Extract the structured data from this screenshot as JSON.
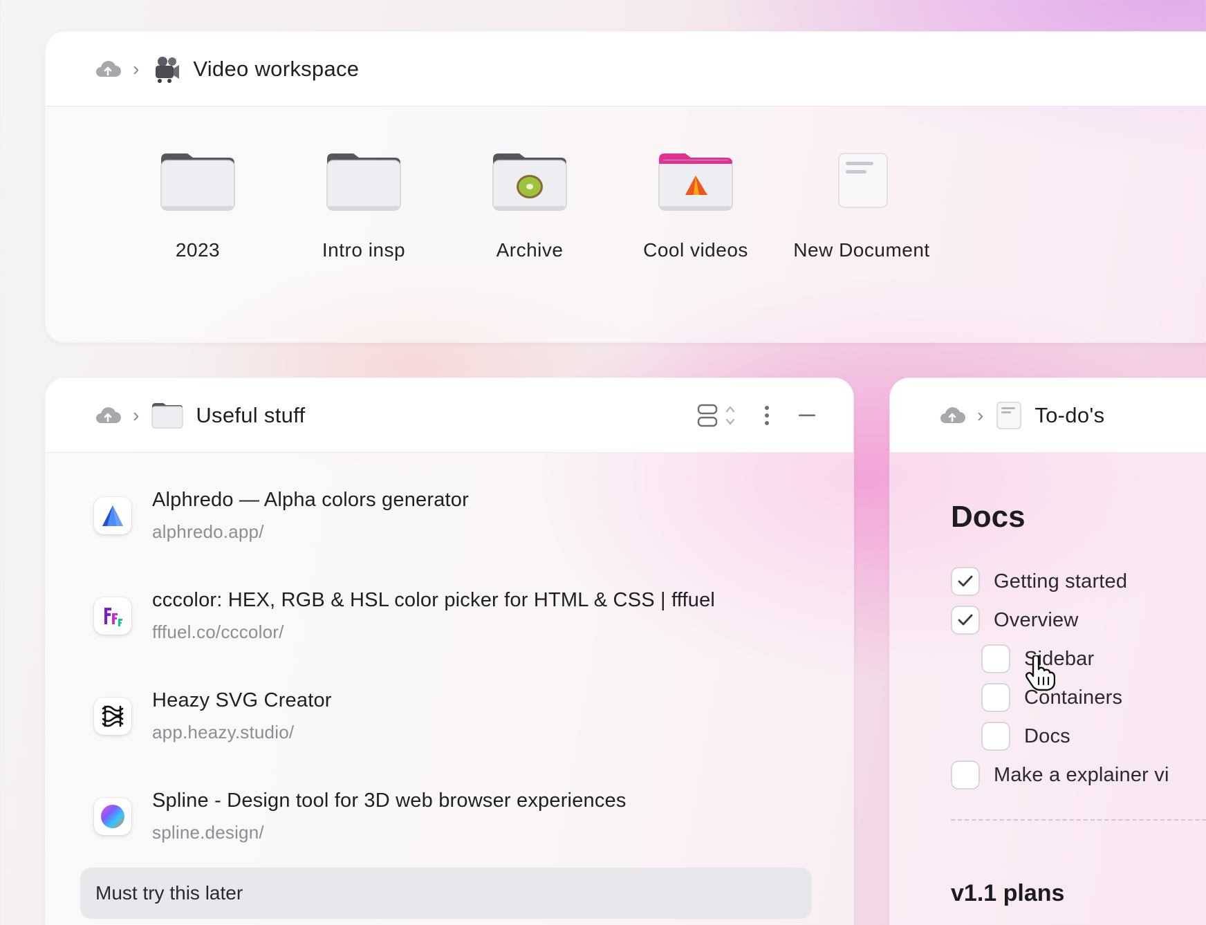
{
  "top_panel": {
    "breadcrumb": {
      "title": "Video workspace"
    },
    "items": [
      {
        "label": "2023",
        "kind": "folder"
      },
      {
        "label": "Intro insp",
        "kind": "folder"
      },
      {
        "label": "Archive",
        "kind": "folder-kiwi"
      },
      {
        "label": "Cool videos",
        "kind": "folder-pink-tent"
      },
      {
        "label": "New Document",
        "kind": "document"
      }
    ]
  },
  "useful_panel": {
    "breadcrumb": {
      "title": "Useful stuff"
    },
    "links": [
      {
        "title": "Alphredo — Alpha colors generator",
        "url": "alphredo.app/",
        "icon": "alphredo-icon"
      },
      {
        "title": "cccolor: HEX, RGB & HSL color picker for HTML & CSS | fffuel",
        "url": "fffuel.co/cccolor/",
        "icon": "fffuel-icon"
      },
      {
        "title": "Heazy SVG Creator",
        "url": "app.heazy.studio/",
        "icon": "heazy-icon"
      },
      {
        "title": "Spline - Design tool for 3D web browser experiences",
        "url": "spline.design/",
        "icon": "spline-icon"
      }
    ],
    "note": "Must try this later"
  },
  "todo_panel": {
    "breadcrumb": {
      "title": "To-do's"
    },
    "heading": "Docs",
    "items": [
      {
        "label": "Getting started",
        "checked": true
      },
      {
        "label": "Overview",
        "checked": true
      },
      {
        "label": "Sidebar",
        "checked": false
      },
      {
        "label": "Containers",
        "checked": false
      },
      {
        "label": "Docs",
        "checked": false
      },
      {
        "label": "Make a explainer vi",
        "checked": false
      }
    ],
    "heading2": "v1.1 plans"
  },
  "colors": {
    "accent_pink": "#e0338f",
    "background_pink": "#f2a0d6"
  }
}
